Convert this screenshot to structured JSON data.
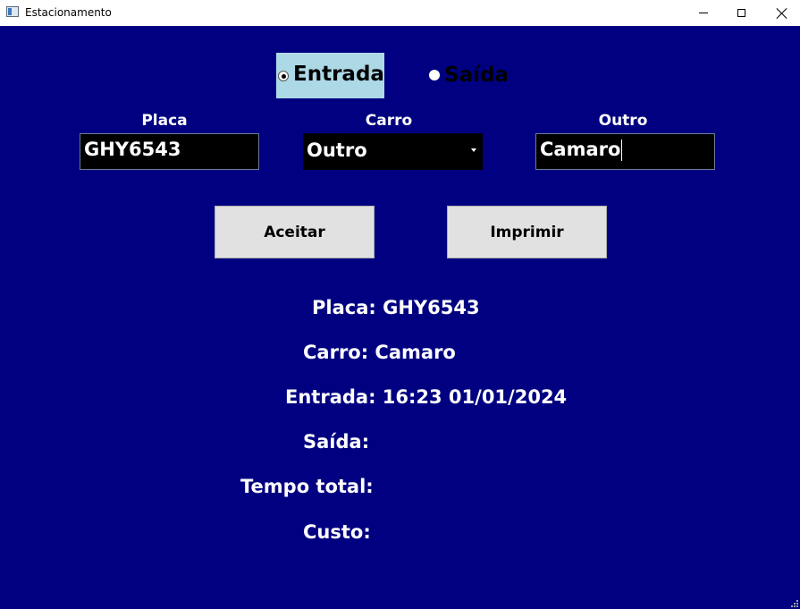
{
  "window": {
    "title": "Estacionamento",
    "icon": "app-window-icon",
    "controls": [
      "minimize-icon",
      "maximize-icon",
      "close-icon"
    ]
  },
  "mode": {
    "entrada_label": "Entrada",
    "saida_label": "Saída",
    "selected": "Entrada"
  },
  "fields": {
    "placa_label": "Placa",
    "carro_label": "Carro",
    "outro_label": "Outro",
    "placa_value": "GHY6543",
    "carro_value": "Outro",
    "outro_value": "Camaro"
  },
  "buttons": {
    "aceitar": "Aceitar",
    "imprimir": "Imprimir"
  },
  "info": {
    "placa": "Placa: GHY6543",
    "carro": "Carro: Camaro",
    "entrada": "Entrada: 16:23 01/01/2024",
    "saida": "Saída:",
    "tempo_total": "Tempo total:",
    "custo": "Custo:"
  },
  "colors": {
    "background": "#000080",
    "selected_radio_bg": "#add8e6",
    "button_bg": "#e1e1e1",
    "text": "#ffffff"
  }
}
